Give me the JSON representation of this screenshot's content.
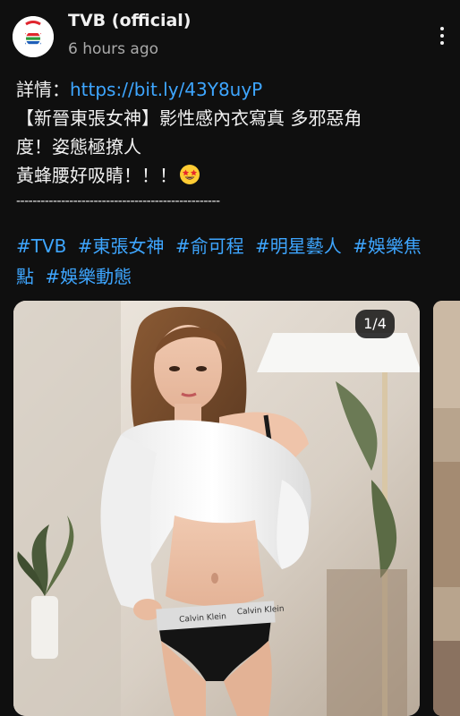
{
  "channel": {
    "name": "TVB (official)",
    "time": "6 hours ago"
  },
  "post": {
    "details_label": "詳情：",
    "link": "https://bit.ly/43Y8uyP",
    "line2": "【新晉東張女神】影性感內衣寫真 多邪惡角",
    "line3": "度！姿態極撩人",
    "line4": "黃蜂腰好吸睛！！！",
    "emoji": "star-struck-emoji",
    "divider": "--------------------------------------------------"
  },
  "hashtags": {
    "row1": [
      "#TVB",
      "#東張女神",
      "#俞可程",
      "#明星藝人",
      "#娛樂焦"
    ],
    "row2": [
      "點",
      "#娛樂動態"
    ]
  },
  "carousel": {
    "page_indicator": "1/4",
    "waistband_text": "Calvin Klein"
  },
  "icons": {
    "avatar": "tvb-logo-icon",
    "more": "more-vertical-icon"
  },
  "colors": {
    "background": "#0f0f0f",
    "link": "#3ea6ff",
    "secondary_text": "#aaaaaa"
  }
}
